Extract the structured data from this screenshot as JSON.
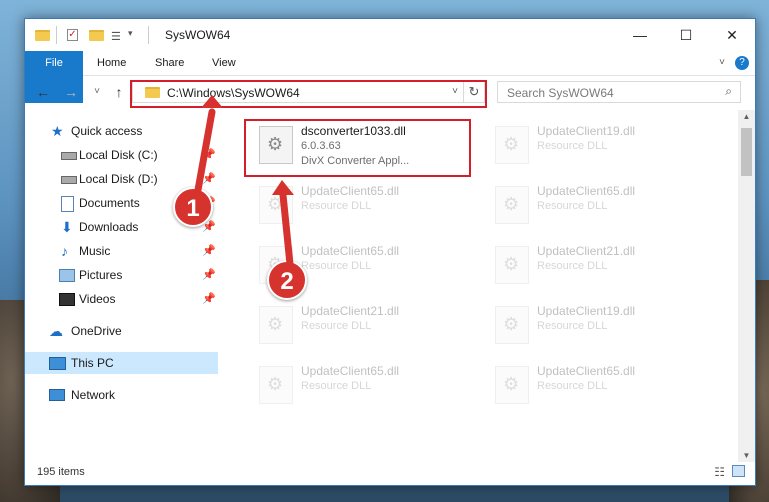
{
  "window": {
    "title": "SysWOW64",
    "controls": {
      "minimize": "—",
      "maximize": "☐",
      "close": "✕"
    }
  },
  "ribbon": {
    "tabs": [
      "File",
      "Home",
      "Share",
      "View"
    ],
    "help": "?"
  },
  "navigation": {
    "back": "←",
    "forward": "→",
    "recent": "˅",
    "up": "↑",
    "address": "C:\\Windows\\SysWOW64",
    "address_dropdown": "˅",
    "refresh": "↻",
    "search_placeholder": "Search SysWOW64"
  },
  "sidebar": {
    "items": [
      {
        "label": "Quick access",
        "icon": "star-icon",
        "pinned": false
      },
      {
        "label": "Local Disk (C:)",
        "icon": "drive-icon",
        "pinned": true
      },
      {
        "label": "Local Disk (D:)",
        "icon": "drive-icon",
        "pinned": true
      },
      {
        "label": "Documents",
        "icon": "documents-icon",
        "pinned": true
      },
      {
        "label": "Downloads",
        "icon": "downloads-icon",
        "pinned": true
      },
      {
        "label": "Music",
        "icon": "music-icon",
        "pinned": true
      },
      {
        "label": "Pictures",
        "icon": "pictures-icon",
        "pinned": true
      },
      {
        "label": "Videos",
        "icon": "videos-icon",
        "pinned": true
      },
      {
        "label": "OneDrive",
        "icon": "onedrive-icon",
        "pinned": false
      },
      {
        "label": "This PC",
        "icon": "pc-icon",
        "selected": true
      },
      {
        "label": "Network",
        "icon": "network-icon",
        "pinned": false
      }
    ]
  },
  "files": [
    {
      "name": "dsconverter1033.dll",
      "line2": "6.0.3.63",
      "line3": "DivX Converter Appl..."
    },
    {
      "name": "UpdateClient19.dll",
      "line2": "Resource DLL"
    },
    {
      "name": "UpdateClient65.dll",
      "line2": "Resource DLL"
    },
    {
      "name": "UpdateClient65.dll",
      "line2": "Resource DLL"
    },
    {
      "name": "UpdateClient65.dll",
      "line2": "Resource DLL"
    },
    {
      "name": "UpdateClient21.dll",
      "line2": "Resource DLL"
    },
    {
      "name": "UpdateClient21.dll",
      "line2": "Resource DLL"
    },
    {
      "name": "UpdateClient19.dll",
      "line2": "Resource DLL"
    },
    {
      "name": "UpdateClient65.dll",
      "line2": "Resource DLL"
    },
    {
      "name": "UpdateClient65.dll",
      "line2": "Resource DLL"
    }
  ],
  "status": {
    "item_count": "195 items"
  },
  "annotations": {
    "step1": "1",
    "step2": "2",
    "highlight_color": "#d21f2b"
  }
}
